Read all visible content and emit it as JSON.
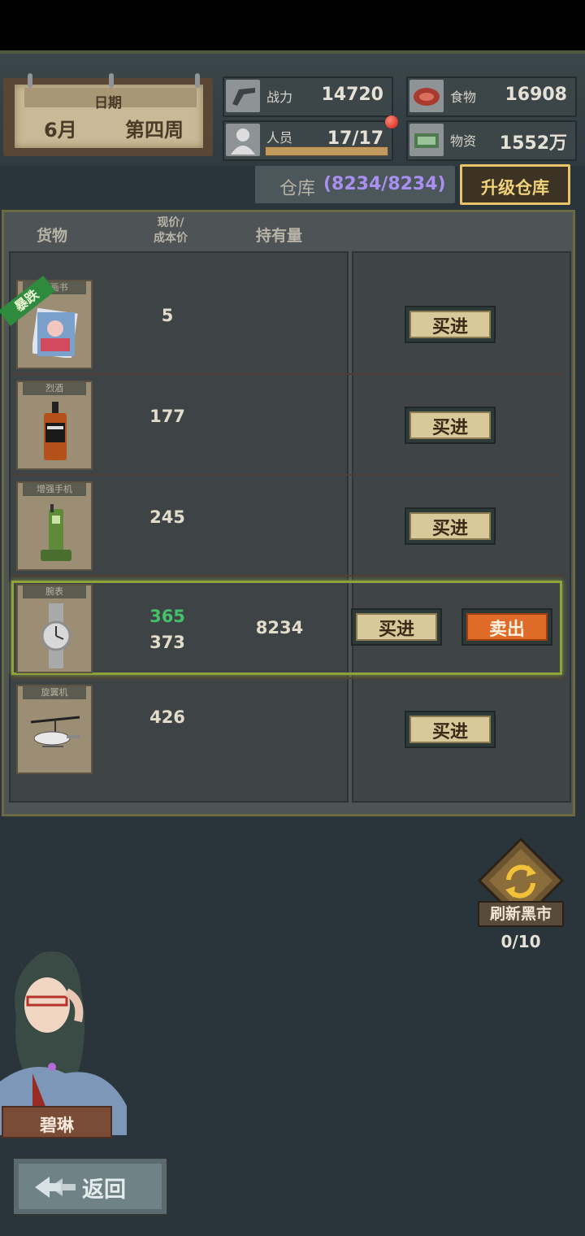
{
  "date": {
    "label": "日期",
    "month": "6月",
    "week": "第四周"
  },
  "stats": [
    {
      "label": "战力",
      "value": "14720",
      "icon": "pistol-icon"
    },
    {
      "label": "食物",
      "value": "16908",
      "icon": "meat-icon"
    },
    {
      "label": "人员",
      "value": "17/17",
      "icon": "person-icon"
    },
    {
      "label": "物资",
      "value": "1552万",
      "icon": "money-icon"
    }
  ],
  "warehouse": {
    "label": "仓库",
    "count": "(8234/8234)",
    "upgrade": "升级仓库"
  },
  "columns": {
    "goods": "货物",
    "price": "现价/\n成本价",
    "held": "持有量"
  },
  "items": [
    {
      "name": "漫画书",
      "price": "5",
      "badge": "暴跌",
      "buy": "买进"
    },
    {
      "name": "烈酒",
      "price": "177",
      "buy": "买进"
    },
    {
      "name": "增强手机",
      "price": "245",
      "buy": "买进"
    },
    {
      "name": "腕表",
      "price": "365",
      "cost": "373",
      "held": "8234",
      "buy": "买进",
      "sell": "卖出"
    },
    {
      "name": "旋翼机",
      "price": "426",
      "buy": "买进"
    }
  ],
  "refresh": {
    "label": "刷新黑市",
    "count": "0/10"
  },
  "character": {
    "name": "碧琳"
  },
  "back": {
    "label": "返回"
  },
  "colors": {
    "accent": "#e8c36a",
    "warehouse_count": "#a98ff0",
    "price_up": "#45c16a",
    "sell": "#e06a28"
  }
}
